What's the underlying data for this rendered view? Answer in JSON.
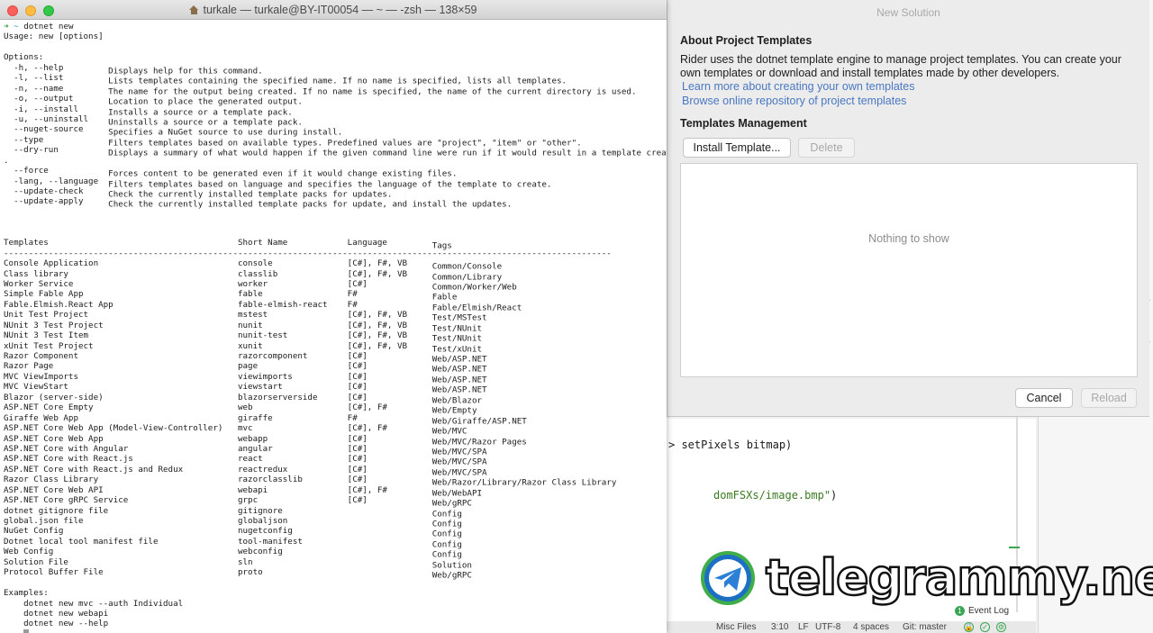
{
  "terminal": {
    "title": "turkale — turkale@BY-IT00054 — ~ — -zsh — 138×59",
    "command": "dotnet new",
    "usage": "Usage: new [options]",
    "options_heading": "Options:",
    "options": [
      {
        "flag": "  -h, --help",
        "desc": "Displays help for this command."
      },
      {
        "flag": "  -l, --list",
        "desc": "Lists templates containing the specified name. If no name is specified, lists all templates."
      },
      {
        "flag": "  -n, --name",
        "desc": "The name for the output being created. If no name is specified, the name of the current directory is used."
      },
      {
        "flag": "  -o, --output",
        "desc": "Location to place the generated output."
      },
      {
        "flag": "  -i, --install",
        "desc": "Installs a source or a template pack."
      },
      {
        "flag": "  -u, --uninstall",
        "desc": "Uninstalls a source or a template pack."
      },
      {
        "flag": "  --nuget-source",
        "desc": "Specifies a NuGet source to use during install."
      },
      {
        "flag": "  --type",
        "desc": "Filters templates based on available types. Predefined values are \"project\", \"item\" or \"other\"."
      },
      {
        "flag": "  --dry-run",
        "desc": "Displays a summary of what would happen if the given command line were run if it would result in a template creation"
      },
      {
        "flag": ".",
        "desc": ""
      },
      {
        "flag": "  --force",
        "desc": "Forces content to be generated even if it would change existing files."
      },
      {
        "flag": "  -lang, --language",
        "desc": "Filters templates based on language and specifies the language of the template to create."
      },
      {
        "flag": "  --update-check",
        "desc": "Check the currently installed template packs for updates."
      },
      {
        "flag": "  --update-apply",
        "desc": "Check the currently installed template packs for update, and install the updates."
      }
    ],
    "table_headers": {
      "template": "Templates",
      "short": "Short Name",
      "lang": "Language",
      "tags": "Tags"
    },
    "table_rule": "--------------------------------------------------------------------------------------------------------------------------",
    "templates": [
      [
        "Console Application",
        "console",
        "[C#], F#, VB",
        "Common/Console"
      ],
      [
        "Class library",
        "classlib",
        "[C#], F#, VB",
        "Common/Library"
      ],
      [
        "Worker Service",
        "worker",
        "[C#]",
        "Common/Worker/Web"
      ],
      [
        "Simple Fable App",
        "fable",
        "F#",
        "Fable"
      ],
      [
        "Fable.Elmish.React App",
        "fable-elmish-react",
        "F#",
        "Fable/Elmish/React"
      ],
      [
        "Unit Test Project",
        "mstest",
        "[C#], F#, VB",
        "Test/MSTest"
      ],
      [
        "NUnit 3 Test Project",
        "nunit",
        "[C#], F#, VB",
        "Test/NUnit"
      ],
      [
        "NUnit 3 Test Item",
        "nunit-test",
        "[C#], F#, VB",
        "Test/NUnit"
      ],
      [
        "xUnit Test Project",
        "xunit",
        "[C#], F#, VB",
        "Test/xUnit"
      ],
      [
        "Razor Component",
        "razorcomponent",
        "[C#]",
        "Web/ASP.NET"
      ],
      [
        "Razor Page",
        "page",
        "[C#]",
        "Web/ASP.NET"
      ],
      [
        "MVC ViewImports",
        "viewimports",
        "[C#]",
        "Web/ASP.NET"
      ],
      [
        "MVC ViewStart",
        "viewstart",
        "[C#]",
        "Web/ASP.NET"
      ],
      [
        "Blazor (server-side)",
        "blazorserverside",
        "[C#]",
        "Web/Blazor"
      ],
      [
        "ASP.NET Core Empty",
        "web",
        "[C#], F#",
        "Web/Empty"
      ],
      [
        "Giraffe Web App",
        "giraffe",
        "F#",
        "Web/Giraffe/ASP.NET"
      ],
      [
        "ASP.NET Core Web App (Model-View-Controller)",
        "mvc",
        "[C#], F#",
        "Web/MVC"
      ],
      [
        "ASP.NET Core Web App",
        "webapp",
        "[C#]",
        "Web/MVC/Razor Pages"
      ],
      [
        "ASP.NET Core with Angular",
        "angular",
        "[C#]",
        "Web/MVC/SPA"
      ],
      [
        "ASP.NET Core with React.js",
        "react",
        "[C#]",
        "Web/MVC/SPA"
      ],
      [
        "ASP.NET Core with React.js and Redux",
        "reactredux",
        "[C#]",
        "Web/MVC/SPA"
      ],
      [
        "Razor Class Library",
        "razorclasslib",
        "[C#]",
        "Web/Razor/Library/Razor Class Library"
      ],
      [
        "ASP.NET Core Web API",
        "webapi",
        "[C#], F#",
        "Web/WebAPI"
      ],
      [
        "ASP.NET Core gRPC Service",
        "grpc",
        "[C#]",
        "Web/gRPC"
      ],
      [
        "dotnet gitignore file",
        "gitignore",
        "",
        "Config"
      ],
      [
        "global.json file",
        "globaljson",
        "",
        "Config"
      ],
      [
        "NuGet Config",
        "nugetconfig",
        "",
        "Config"
      ],
      [
        "Dotnet local tool manifest file",
        "tool-manifest",
        "",
        "Config"
      ],
      [
        "Web Config",
        "webconfig",
        "",
        "Config"
      ],
      [
        "Solution File",
        "sln",
        "",
        "Solution"
      ],
      [
        "Protocol Buffer File",
        "proto",
        "",
        "Web/gRPC"
      ]
    ],
    "examples_heading": "Examples:",
    "examples": [
      "    dotnet new mvc --auth Individual",
      "    dotnet new webapi",
      "    dotnet new --help"
    ],
    "prompt_arrow": "➜",
    "prompt_dir": "~"
  },
  "dialog": {
    "title": "New Solution",
    "about_heading": "About Project Templates",
    "about_text": "Rider uses the dotnet template engine to manage project templates. You can create your own templates or download and install templates made by other developers.",
    "link1": "Learn more about creating your own templates",
    "link2": "Browse online repository of project templates",
    "mgmt_heading": "Templates Management",
    "install_label": "Install Template...",
    "delete_label": "Delete",
    "empty_text": "Nothing to show",
    "cancel_label": "Cancel",
    "reload_label": "Reload"
  },
  "ide": {
    "code_line1": "> setPixels bitmap)",
    "code_line2_str": "domFSXs/image.bmp\"",
    "code_line2_end": ")",
    "side_chars": [
      "o",
      "o"
    ],
    "event_log_count": "1",
    "event_log_label": "Event Log",
    "status": {
      "misc_files": "Misc Files",
      "position": "3:10",
      "line_ending": "LF",
      "encoding": "UTF-8",
      "indent": "4 spaces",
      "git": "Git: master"
    }
  },
  "watermark": {
    "text": "telegrammy.net",
    "logo_icon": "telegram-plane-icon",
    "logo_color": "#2b7fd4",
    "logo_ring": "#3fae49"
  }
}
